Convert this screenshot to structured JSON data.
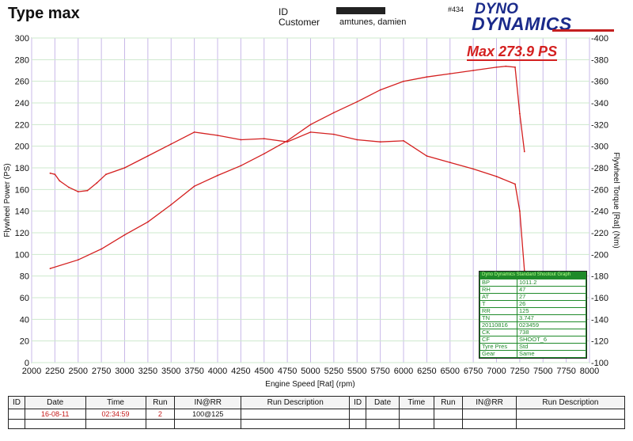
{
  "header": {
    "title": "Type max",
    "id_label": "ID",
    "customer_label": "Customer",
    "customer_value": "amtunes, damien",
    "report_number": "#434",
    "logo_line1": "DYNO",
    "logo_line2": "DYNAMICS"
  },
  "max_label": "Max 273.9 PS",
  "chart_data": {
    "type": "line",
    "xlabel": "Engine Speed [Rat] (rpm)",
    "ylabel_left": "Flywheel Power (PS)",
    "ylabel_right": "Flywheel Torque [Rat] (Nm)",
    "xlim": [
      2000,
      8000
    ],
    "ylim_left": [
      0,
      300
    ],
    "ylim_right": [
      100,
      400
    ],
    "x_ticks": [
      2000,
      2250,
      2500,
      2750,
      3000,
      3250,
      3500,
      3750,
      4000,
      4250,
      4500,
      4750,
      5000,
      5250,
      5500,
      5750,
      6000,
      6250,
      6500,
      6750,
      7000,
      7250,
      7500,
      7750,
      8000
    ],
    "y_left_ticks": [
      0,
      20,
      40,
      60,
      80,
      100,
      120,
      140,
      160,
      180,
      200,
      220,
      240,
      260,
      280,
      300
    ],
    "y_right_ticks": [
      100,
      120,
      140,
      160,
      180,
      200,
      220,
      240,
      260,
      280,
      300,
      320,
      340,
      360,
      380,
      400
    ],
    "grid": true,
    "series": [
      {
        "axis": "left",
        "x": [
          2200,
          2500,
          2750,
          3000,
          3250,
          3500,
          3750,
          4000,
          4250,
          4500,
          4750,
          5000,
          5250,
          5500,
          5750,
          6000,
          6250,
          6500,
          6750,
          7000,
          7100,
          7200,
          7250,
          7300
        ],
        "y": [
          87,
          95,
          105,
          118,
          130,
          146,
          163,
          173,
          182,
          193,
          205,
          220,
          231,
          241,
          252,
          260,
          264,
          267,
          270,
          273,
          273.9,
          273,
          230,
          195
        ]
      },
      {
        "axis": "right",
        "x": [
          2200,
          2250,
          2300,
          2400,
          2500,
          2600,
          2700,
          2800,
          3000,
          3250,
          3500,
          3750,
          4000,
          4250,
          4500,
          4750,
          5000,
          5250,
          5500,
          5750,
          6000,
          6250,
          6500,
          6750,
          7000,
          7200,
          7250,
          7300
        ],
        "y": [
          275,
          274,
          268,
          262,
          258,
          259,
          266,
          274,
          280,
          291,
          302,
          313,
          310,
          306,
          307,
          304,
          313,
          311,
          306,
          304,
          305,
          291,
          285,
          279,
          272,
          265,
          240,
          185
        ]
      }
    ]
  },
  "info_box": {
    "title": "Dyno Dynamics Standard Shootout Graph",
    "rows": [
      {
        "k": "BP",
        "v": "1011.2"
      },
      {
        "k": "RH",
        "v": "47"
      },
      {
        "k": "AT",
        "v": "27"
      },
      {
        "k": "T",
        "v": "26"
      },
      {
        "k": "RR",
        "v": "125"
      },
      {
        "k": "TN",
        "v": "3.747"
      },
      {
        "k": "20110816",
        "v": "023459"
      },
      {
        "k": "CK",
        "v": "738"
      },
      {
        "k": "CF",
        "v": "SHOOT_6"
      },
      {
        "k": "Tyre Pres",
        "v": "Std"
      },
      {
        "k": "Gear",
        "v": "Same"
      }
    ]
  },
  "runs_table": {
    "headers": [
      "ID",
      "Date",
      "Time",
      "Run",
      "IN@RR",
      "Run Description",
      "ID",
      "Date",
      "Time",
      "Run",
      "IN@RR",
      "Run Description"
    ],
    "row": {
      "id": "",
      "date": "16-08-11",
      "time": "02:34:59",
      "run": "2",
      "inrr": "100@125",
      "desc": ""
    }
  },
  "colors": {
    "grid_vertical": "#c8b8e8",
    "grid_horizontal": "#cde8cd",
    "curve": "#d42020",
    "info_green": "#1f8a2a"
  }
}
